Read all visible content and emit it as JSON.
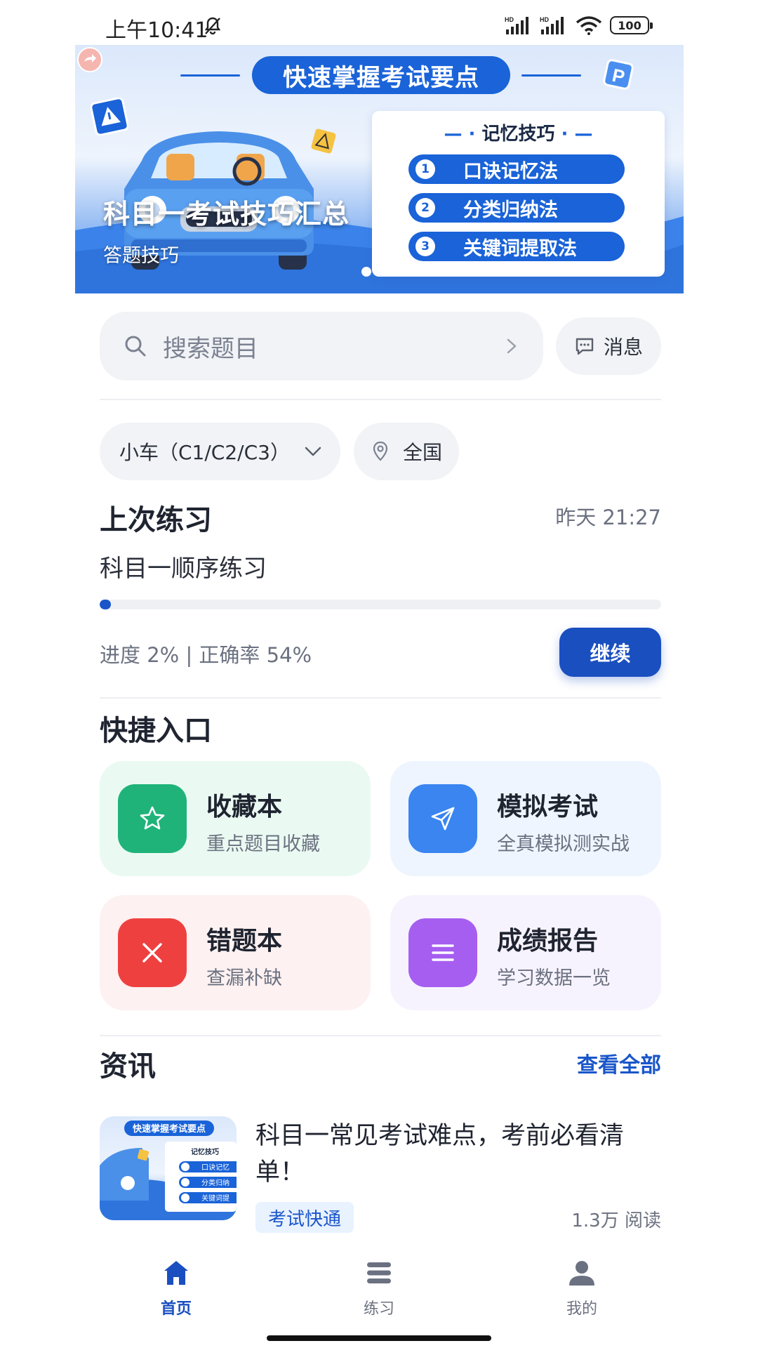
{
  "status_bar": {
    "time": "上午10:41",
    "battery": "100"
  },
  "banner": {
    "pill_text": "快速掌握考试要点",
    "tips_title": "记忆技巧",
    "tips": [
      {
        "num": "1",
        "label": "口诀记忆法"
      },
      {
        "num": "2",
        "label": "分类归纳法"
      },
      {
        "num": "3",
        "label": "关键词提取法"
      }
    ],
    "title": "科目一考试技巧汇总",
    "subtitle": "答题技巧"
  },
  "search": {
    "placeholder": "搜索题目"
  },
  "message_button": {
    "label": "消息"
  },
  "filters": {
    "license_type": "小车（C1/C2/C3）",
    "region": "全国"
  },
  "last_practice": {
    "heading": "上次练习",
    "time": "昨天 21:27",
    "name": "科目一顺序练习",
    "progress_percent": 2,
    "stats_text": "进度 2% | 正确率 54%",
    "continue_label": "继续"
  },
  "quick_access": {
    "heading": "快捷入口",
    "cards": [
      {
        "title": "收藏本",
        "subtitle": "重点题目收藏",
        "icon": "star-icon",
        "color": "#1fb37a",
        "bg": "#eafaf2"
      },
      {
        "title": "模拟考试",
        "subtitle": "全真模拟测实战",
        "icon": "paper-plane-icon",
        "color": "#3a85f0",
        "bg": "#eef5ff"
      },
      {
        "title": "错题本",
        "subtitle": "查漏补缺",
        "icon": "close-icon",
        "color": "#ef4040",
        "bg": "#fdf1f1"
      },
      {
        "title": "成绩报告",
        "subtitle": "学习数据一览",
        "icon": "list-icon",
        "color": "#a55ef0",
        "bg": "#f7f3fe"
      }
    ]
  },
  "news": {
    "heading": "资讯",
    "view_all": "查看全部",
    "items": [
      {
        "title": "科目一常见考试难点，考前必看清单！",
        "tag": "考试快通",
        "reads": "1.3万 阅读"
      }
    ],
    "thumb": {
      "pill_text": "快速掌握考试要点",
      "tips_title": "记忆技巧",
      "tips": [
        "口诀记忆",
        "分类归纳",
        "关键词提"
      ]
    }
  },
  "bottom_nav": [
    {
      "label": "首页",
      "icon": "home-icon",
      "active": true
    },
    {
      "label": "练习",
      "icon": "layers-icon",
      "active": false
    },
    {
      "label": "我的",
      "icon": "user-icon",
      "active": false
    }
  ],
  "colors": {
    "primary": "#1a4fc0",
    "accent": "#1a56c9",
    "text": "#1f2430",
    "muted": "#6b7180"
  }
}
